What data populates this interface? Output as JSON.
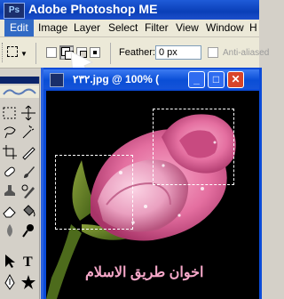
{
  "app": {
    "title": "Adobe Photoshop ME",
    "logo_text": "Ps"
  },
  "menubar": {
    "items": [
      "Edit",
      "Image",
      "Layer",
      "Select",
      "Filter",
      "View",
      "Window",
      "H"
    ]
  },
  "options": {
    "feather_label": "Feather:",
    "feather_value": "0 px",
    "antialiased_label": "Anti-aliased"
  },
  "document": {
    "title": "٢٣٢.jpg @ 100% (",
    "minimize": "_",
    "maximize": "□",
    "close": "✕"
  },
  "canvas": {
    "watermark": "اخوان طريق الاسلام"
  },
  "colors": {
    "title_blue": "#0a3fb8",
    "menu_bg": "#ece9d8",
    "rose_pink": "#e46fa0",
    "close_red": "#d8452a"
  },
  "icons": [
    "selection-new-icon",
    "selection-add-icon",
    "selection-subtract-icon",
    "selection-intersect-icon",
    "marquee-icon",
    "move-icon",
    "lasso-icon",
    "magic-wand-icon",
    "crop-icon",
    "slice-icon",
    "healing-icon",
    "brush-icon",
    "stamp-icon",
    "history-brush-icon",
    "eraser-icon",
    "bucket-icon",
    "blur-icon",
    "dodge-icon",
    "path-select-icon",
    "type-icon",
    "pen-icon",
    "shape-icon"
  ]
}
